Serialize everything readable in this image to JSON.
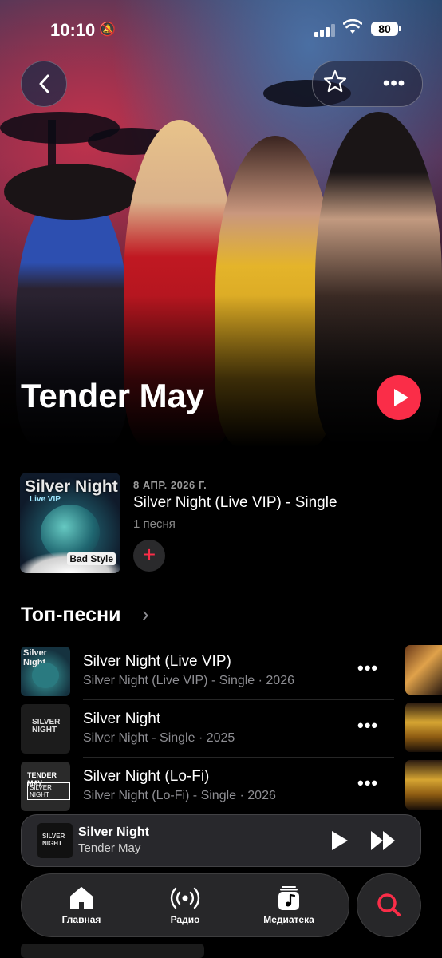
{
  "status_bar": {
    "time": "10:10",
    "battery": "80"
  },
  "header": {
    "artist_name": "Tender May"
  },
  "latest_release": {
    "date": "8 АПР. 2026 Г.",
    "title": "Silver Night (Live VIP) - Single",
    "count": "1 песня",
    "artwork": {
      "title": "Silver Night",
      "subtitle": "Live VIP",
      "badge": "Bad Style"
    }
  },
  "top_songs": {
    "title": "Топ-песни",
    "items": [
      {
        "name": "Silver Night (Live VIP)",
        "meta": "Silver Night (Live VIP) - Single · 2026"
      },
      {
        "name": "Silver Night",
        "meta": "Silver Night - Single · 2025"
      },
      {
        "name": "Silver Night (Lo-Fi)",
        "meta": "Silver Night (Lo-Fi) - Single · 2026"
      }
    ]
  },
  "mini_player": {
    "title": "Silver Night",
    "artist": "Tender May"
  },
  "tab_bar": {
    "home": "Главная",
    "radio": "Радио",
    "library": "Медиатека"
  },
  "colors": {
    "accent": "#fa2d48",
    "background": "#000000",
    "secondary_text": "#8e8e93"
  },
  "icons": [
    "back-icon",
    "star-icon",
    "more-icon",
    "play-icon",
    "plus-icon",
    "chevron-right-icon",
    "home-icon",
    "radio-icon",
    "library-icon",
    "search-icon",
    "fast-forward-icon"
  ]
}
